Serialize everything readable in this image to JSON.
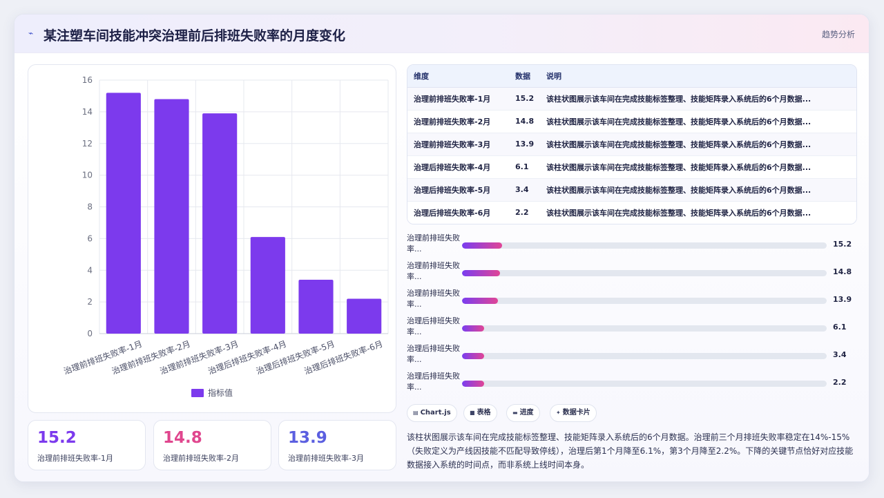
{
  "header": {
    "title": "某注塑车间技能冲突治理前后排班失败率的月度变化",
    "tag": "趋势分析"
  },
  "chart_data": {
    "type": "bar",
    "categories": [
      "治理前排班失败率-1月",
      "治理前排班失败率-2月",
      "治理前排班失败率-3月",
      "治理后排班失败率-4月",
      "治理后排班失败率-5月",
      "治理后排班失败率-6月"
    ],
    "series": [
      {
        "name": "指标值",
        "values": [
          15.2,
          14.8,
          13.9,
          6.1,
          3.4,
          2.2
        ]
      }
    ],
    "ylim": [
      0,
      16
    ],
    "yticks": [
      "0",
      "2",
      "4",
      "6",
      "8",
      "10",
      "12",
      "14",
      "16"
    ],
    "grid": true,
    "legend": "bottom",
    "bar_color": "#7c3aed"
  },
  "stats": [
    {
      "value": "15.2",
      "label": "治理前排班失败率-1月",
      "color": "#7c3aed"
    },
    {
      "value": "14.8",
      "label": "治理前排班失败率-2月",
      "color": "#e0468e"
    },
    {
      "value": "13.9",
      "label": "治理前排班失败率-3月",
      "color": "#5b5fe0"
    }
  ],
  "table": {
    "headers": [
      "维度",
      "数据",
      "说明"
    ],
    "rows": [
      [
        "治理前排班失败率-1月",
        "15.2",
        "该柱状图展示该车间在完成技能标签整理、技能矩阵录入系统后的6个月数据..."
      ],
      [
        "治理前排班失败率-2月",
        "14.8",
        "该柱状图展示该车间在完成技能标签整理、技能矩阵录入系统后的6个月数据..."
      ],
      [
        "治理前排班失败率-3月",
        "13.9",
        "该柱状图展示该车间在完成技能标签整理、技能矩阵录入系统后的6个月数据..."
      ],
      [
        "治理后排班失败率-4月",
        "6.1",
        "该柱状图展示该车间在完成技能标签整理、技能矩阵录入系统后的6个月数据..."
      ],
      [
        "治理后排班失败率-5月",
        "3.4",
        "该柱状图展示该车间在完成技能标签整理、技能矩阵录入系统后的6个月数据..."
      ],
      [
        "治理后排班失败率-6月",
        "2.2",
        "该柱状图展示该车间在完成技能标签整理、技能矩阵录入系统后的6个月数据..."
      ]
    ]
  },
  "progress": [
    {
      "label": "治理前排班失败率...",
      "value": "15.2",
      "fraction": 0.11
    },
    {
      "label": "治理前排班失败率...",
      "value": "14.8",
      "fraction": 0.105
    },
    {
      "label": "治理前排班失败率...",
      "value": "13.9",
      "fraction": 0.098
    },
    {
      "label": "治理后排班失败率...",
      "value": "6.1",
      "fraction": 0.06
    },
    {
      "label": "治理后排班失败率...",
      "value": "3.4",
      "fraction": 0.06
    },
    {
      "label": "治理后排班失败率...",
      "value": "2.2",
      "fraction": 0.06
    }
  ],
  "chips": [
    {
      "icon": "chart-icon",
      "glyph": "▤",
      "label": "Chart.js"
    },
    {
      "icon": "table-icon",
      "glyph": "■",
      "label": "表格"
    },
    {
      "icon": "progress-icon",
      "glyph": "▬",
      "label": "进度"
    },
    {
      "icon": "card-icon",
      "glyph": "✦",
      "label": "数据卡片"
    }
  ],
  "description": "该柱状图展示该车间在完成技能标签整理、技能矩阵录入系统后的6个月数据。治理前三个月排班失败率稳定在14%-15%（失败定义为产线因技能不匹配导致停线），治理后第1个月降至6.1%，第3个月降至2.2%。下降的关键节点恰好对应技能数据接入系统的时间点，而非系统上线时间本身。"
}
